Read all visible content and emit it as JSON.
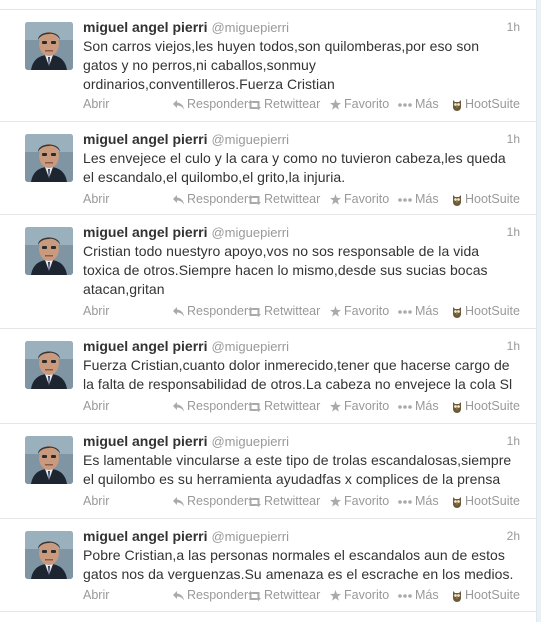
{
  "colors": {
    "name": "#333333",
    "muted": "#999999",
    "text": "#333333",
    "background": "#ffffff"
  },
  "actions": {
    "open": "Abrir",
    "reply": "Responder",
    "retweet": "Retwittear",
    "favorite": "Favorito",
    "more": "Más",
    "hootsuite": "HootSuite"
  },
  "tweets": [
    {
      "fullname": "miguel angel pierri",
      "username": "@miguepierri",
      "time": "1h",
      "lines": [
        "Son carros viejos,les huyen todos,son quilomberas,por eso son",
        "gatos y no perros,ni caballos,sonmuy",
        "ordinarios,conventilleros.Fuerza Cristian"
      ]
    },
    {
      "fullname": "miguel angel pierri",
      "username": "@miguepierri",
      "time": "1h",
      "lines": [
        "Les envejece el culo y la cara y como no tuvieron cabeza,les queda",
        "el escandalo,el quilombo,el grito,la injuria."
      ]
    },
    {
      "fullname": "miguel angel pierri",
      "username": "@miguepierri",
      "time": "1h",
      "lines": [
        "Cristian todo nuestyro apoyo,vos no sos responsable de la vida",
        "toxica de otros.Siempre hacen lo mismo,desde sus sucias bocas",
        "atacan,gritan"
      ]
    },
    {
      "fullname": "miguel angel pierri",
      "username": "@miguepierri",
      "time": "1h",
      "lines": [
        "Fuerza Cristian,cuanto dolor inmerecido,tener que hacerse cargo de",
        "la falta de responsabilidad de otros.La cabeza no envejece la cola Sl"
      ]
    },
    {
      "fullname": "miguel angel pierri",
      "username": "@miguepierri",
      "time": "1h",
      "lines": [
        "Es lamentable vincularse a este tipo de trolas escandalosas,siempre",
        "el quilombo es su herramienta ayudadfas x complices de la prensa"
      ]
    },
    {
      "fullname": "miguel angel pierri",
      "username": "@miguepierri",
      "time": "2h",
      "lines": [
        "Pobre Cristian,a las personas normales el escandalos aun de estos",
        "gatos nos da verguenzas.Su amenaza es el escrache en los medios."
      ]
    }
  ]
}
